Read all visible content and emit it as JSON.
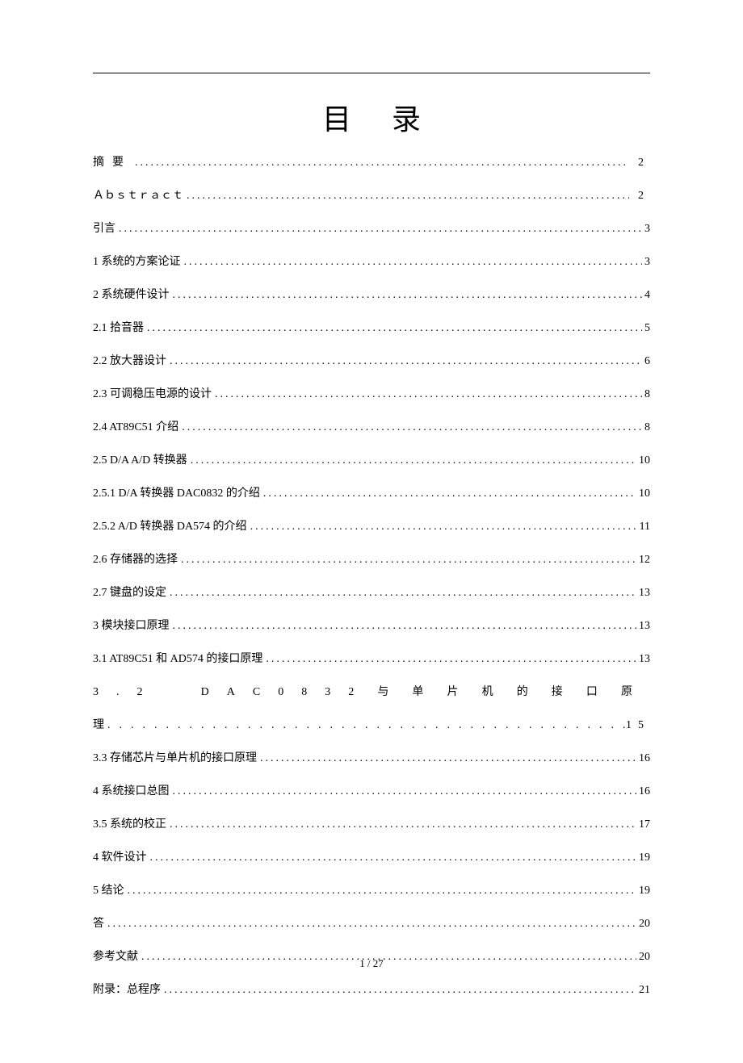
{
  "title": "目录",
  "footer": "1 / 27",
  "toc": [
    {
      "label": "摘要",
      "page": " 2",
      "label_spread": true,
      "page_spread": true
    },
    {
      "label": "Ａｂｓｔｒａｃｔ",
      "page": " 2",
      "label_spread": false,
      "page_spread": true
    },
    {
      "label": "引言",
      "page": " 3",
      "label_spread": false,
      "page_spread": false
    },
    {
      "label": "1 系统的方案论证",
      "page": " 3",
      "label_spread": false,
      "page_spread": false
    },
    {
      "label": "2 系统硬件设计",
      "page": " 4",
      "label_spread": false,
      "page_spread": false
    },
    {
      "label": "2.1 拾音器",
      "page": " 5",
      "label_spread": false,
      "page_spread": false
    },
    {
      "label": "2.2 放大器设计",
      "page": " 6",
      "label_spread": false,
      "page_spread": false
    },
    {
      "label": "2.3 可调稳压电源的设计",
      "page": " 8",
      "label_spread": false,
      "page_spread": false
    },
    {
      "label": "2.4 AT89C51 介绍",
      "page": " 8",
      "label_spread": false,
      "page_spread": false
    },
    {
      "label": "2.5 D/A A/D 转换器",
      "page": " 10",
      "label_spread": false,
      "page_spread": false
    },
    {
      "label": "2.5.1 D/A 转换器 DAC0832 的介绍",
      "page": " 10",
      "label_spread": false,
      "page_spread": false
    },
    {
      "label": "2.5.2 A/D 转换器 DA574 的介绍",
      "page": " 11",
      "label_spread": false,
      "page_spread": false
    },
    {
      "label": "2.6 存储器的选择",
      "page": " 12",
      "label_spread": false,
      "page_spread": false
    },
    {
      "label": "2.7 键盘的设定",
      "page": " 13",
      "label_spread": false,
      "page_spread": false
    },
    {
      "label": "3 模块接口原理",
      "page": " 13",
      "label_spread": false,
      "page_spread": false
    },
    {
      "label": "3.1 AT89C51 和 AD574 的接口原理",
      "page": " 13",
      "label_spread": false,
      "page_spread": false
    }
  ],
  "toc_wrap": {
    "line1": "3.2　DAC0832与单片机的接口原",
    "line2_label": "理",
    "line2_page": "15"
  },
  "toc_after": [
    {
      "label": "3.3 存储芯片与单片机的接口原理",
      "page": " 16",
      "label_spread": false,
      "page_spread": false
    },
    {
      "label": "4 系统接口总图",
      "page": " 16",
      "label_spread": false,
      "page_spread": false
    },
    {
      "label": "3.5 系统的校正",
      "page": " 17",
      "label_spread": false,
      "page_spread": false
    },
    {
      "label": "4 软件设计",
      "page": " 19",
      "label_spread": false,
      "page_spread": false
    },
    {
      "label": "5 结论",
      "page": " 19",
      "label_spread": false,
      "page_spread": false
    },
    {
      "label": "答",
      "page": " 20",
      "label_spread": false,
      "page_spread": false
    },
    {
      "label": "参考文献",
      "page": " 20",
      "label_spread": false,
      "page_spread": false
    },
    {
      "label": "附录：总程序",
      "page": "  21",
      "label_spread": false,
      "page_spread": false
    }
  ]
}
